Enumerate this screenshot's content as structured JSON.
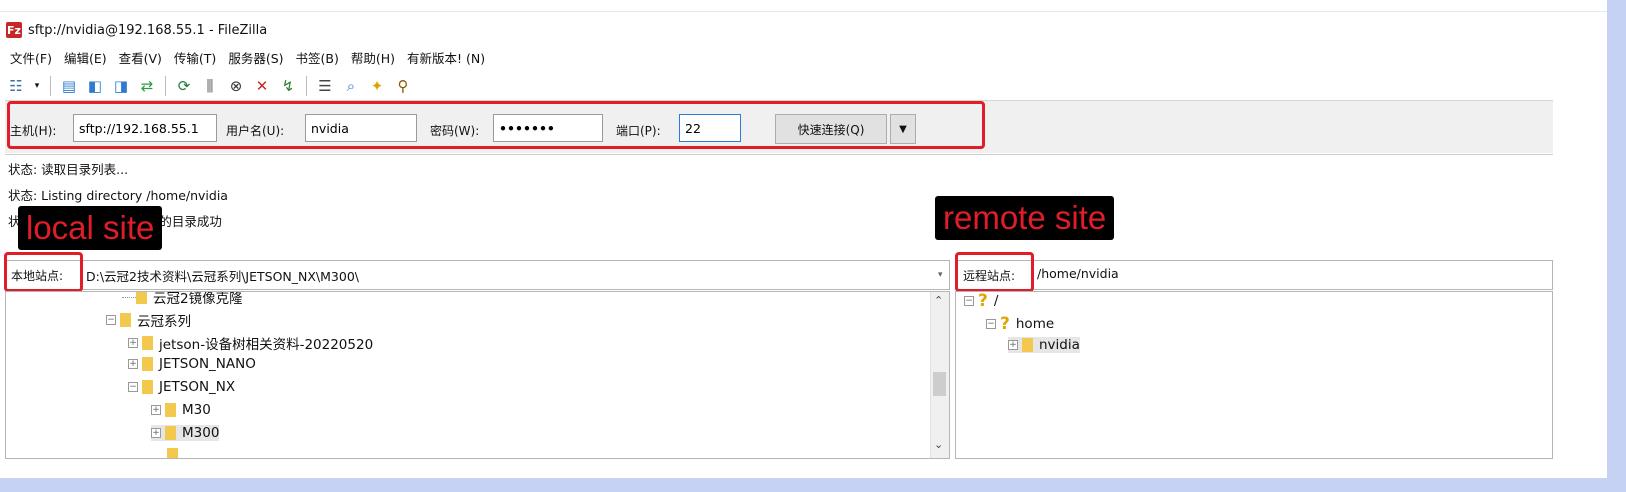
{
  "window": {
    "title": "sftp://nvidia@192.168.55.1 - FileZilla",
    "icon": "filezilla-icon"
  },
  "menu": [
    "文件(F)",
    "编辑(E)",
    "查看(V)",
    "传输(T)",
    "服务器(S)",
    "书签(B)",
    "帮助(H)",
    "有新版本! (N)"
  ],
  "toolbar_icons": [
    "site-manager-icon",
    "dropdown-icon",
    "toggle-log-icon",
    "toggle-local-tree-icon",
    "toggle-remote-tree-icon",
    "toggle-queue-icon",
    "refresh-icon",
    "process-queue-icon",
    "cancel-icon",
    "disconnect-icon",
    "reconnect-icon",
    "filter-icon",
    "search-icon",
    "compare-icon",
    "find-icon"
  ],
  "quickconnect": {
    "host_label": "主机(H):",
    "host_value": "sftp://192.168.55.1",
    "user_label": "用户名(U):",
    "user_value": "nvidia",
    "pass_label": "密码(W):",
    "pass_value": "•••••••",
    "port_label": "端口(P):",
    "port_value": "22",
    "connect_label": "快速连接(Q)",
    "dropdown": "▼"
  },
  "log": [
    "状态: 读取目录列表...",
    "状态: Listing directory /home/nvidia",
    "状态: 列出\"/home/nvidia\"的目录成功"
  ],
  "annotations": {
    "local": "local site",
    "remote": "remote site"
  },
  "local": {
    "label": "本地站点:",
    "path": "D:\\云冠2技术资料\\云冠系列\\JETSON_NX\\M300\\",
    "tree": [
      "云冠2镜像克隆",
      "云冠系列",
      "jetson-设备树相关资料-20220520",
      "JETSON_NANO",
      "JETSON_NX",
      "M30",
      "M300"
    ]
  },
  "remote": {
    "label": "远程站点:",
    "path": "/home/nvidia",
    "tree": [
      "/",
      "home",
      "nvidia"
    ]
  },
  "colors": {
    "highlight": "#e11d2a",
    "folder": "#f2c94c",
    "frame": "#c5d2f4"
  }
}
